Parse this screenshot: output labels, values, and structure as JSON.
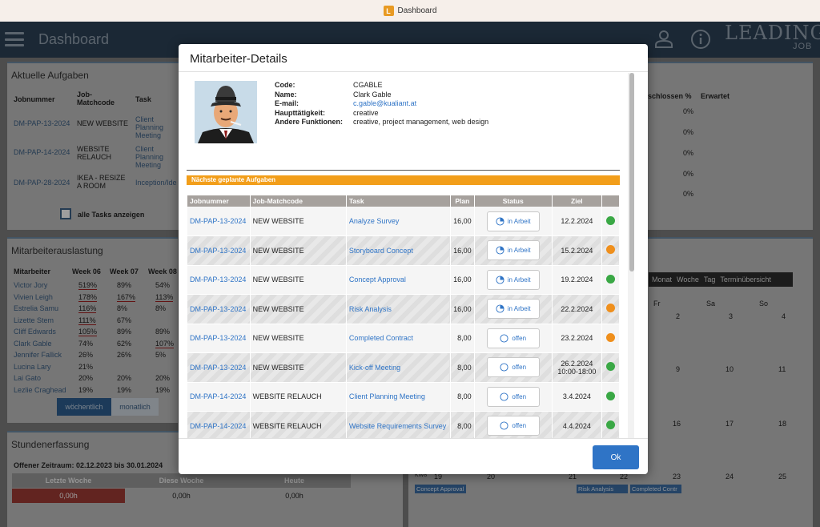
{
  "window": {
    "title": "Dashboard",
    "badge": "L"
  },
  "header": {
    "title": "Dashboard",
    "logo_main": "LEADING",
    "logo_sub": "JOB"
  },
  "background": {
    "tasks_panel": {
      "title": "Aktuelle Aufgaben",
      "columns": [
        "Jobnummer",
        "Job-Matchcode",
        "Task"
      ],
      "rows": [
        {
          "job": "DM-PAP-13-2024",
          "match": "NEW WEBSITE",
          "task": "Client Planning Meeting"
        },
        {
          "job": "DM-PAP-14-2024",
          "match": "WEBSITE RELAUCH",
          "task": "Client Planning Meeting"
        },
        {
          "job": "DM-PAP-28-2024",
          "match": "IKEA - RESIZE A ROOM",
          "task": "Inception/Ide"
        }
      ],
      "checkbox_label": "alle Tasks anzeigen"
    },
    "right_panel": {
      "columns": [
        "schlossen %",
        "Erwartet"
      ],
      "values": [
        "0%",
        "0%",
        "0%",
        "0%",
        "0%"
      ]
    },
    "load_panel": {
      "title": "Mitarbeiterauslastung",
      "columns": [
        "Mitarbeiter",
        "Week 06",
        "Week 07",
        "Week 08"
      ],
      "rows": [
        {
          "name": "Victor Jory",
          "w6": "519%",
          "w7": "89%",
          "w8": "54%"
        },
        {
          "name": "Vivien Leigh",
          "w6": "178%",
          "w7": "167%",
          "w8": "113%"
        },
        {
          "name": "Estrelia Samu",
          "w6": "116%",
          "w7": "8%",
          "w8": "8%"
        },
        {
          "name": "Lizette Stem",
          "w6": "111%",
          "w7": "67%",
          "w8": ""
        },
        {
          "name": "Cliff Edwards",
          "w6": "105%",
          "w7": "89%",
          "w8": "89%"
        },
        {
          "name": "Clark Gable",
          "w6": "74%",
          "w7": "62%",
          "w8": "107%"
        },
        {
          "name": "Jennifer Fallick",
          "w6": "26%",
          "w7": "26%",
          "w8": "5%"
        },
        {
          "name": "Lucina Lary",
          "w6": "21%",
          "w7": "",
          "w8": ""
        },
        {
          "name": "Lai Gato",
          "w6": "20%",
          "w7": "20%",
          "w8": "20%"
        },
        {
          "name": "Lezlie Craghead",
          "w6": "19%",
          "w7": "19%",
          "w8": "19%"
        }
      ],
      "toggle_weekly": "wöchentlich",
      "toggle_monthly": "monatlich"
    },
    "time_panel": {
      "title": "Stundenerfassung",
      "period": "Offener Zeitraum: 02.12.2023 bis 30.01.2024",
      "columns": [
        "Letzte Woche",
        "Diese Woche",
        "Heute"
      ],
      "values": [
        "0,00h",
        "0,00h",
        "0,00h"
      ]
    },
    "calendar": {
      "views": [
        "Monat",
        "Woche",
        "Tag",
        "Terminübersicht"
      ],
      "weekdays": [
        "Fr",
        "Sa",
        "So"
      ],
      "week1": [
        "2",
        "3",
        "4"
      ],
      "week2": [
        "9",
        "10",
        "11"
      ],
      "week3": [
        "16",
        "17",
        "18"
      ],
      "week4_label": "KW8",
      "week4": [
        "19",
        "20",
        "21",
        "22",
        "23",
        "24",
        "25"
      ],
      "events": [
        "Concept Approval",
        "Risk Analysis",
        "Completed Contr"
      ]
    }
  },
  "modal": {
    "title": "Mitarbeiter-Details",
    "info": [
      {
        "label": "Code:",
        "value": "CGABLE"
      },
      {
        "label": "Name:",
        "value": "Clark Gable"
      },
      {
        "label": "E-mail:",
        "value": "c.gable@kualiant.at"
      },
      {
        "label": "Haupttätigkeit:",
        "value": "creative"
      },
      {
        "label": "Andere Funktionen:",
        "value": "creative, project management, web design"
      }
    ],
    "section_title": "Nächste geplante Aufgaben",
    "columns": [
      "Jobnummer",
      "Job-Matchcode",
      "Task",
      "Plan",
      "Status",
      "Ziel",
      ""
    ],
    "rows": [
      {
        "job": "DM-PAP-13-2024",
        "match": "NEW WEBSITE",
        "task": "Analyze Survey",
        "plan": "16,00",
        "status": "in Arbeit",
        "ziel": "12.2.2024",
        "dot": "#3aa845"
      },
      {
        "job": "DM-PAP-13-2024",
        "match": "NEW WEBSITE",
        "task": "Storyboard Concept",
        "plan": "16,00",
        "status": "in Arbeit",
        "ziel": "15.2.2024",
        "dot": "#ef8f1c"
      },
      {
        "job": "DM-PAP-13-2024",
        "match": "NEW WEBSITE",
        "task": "Concept Approval",
        "plan": "16,00",
        "status": "in Arbeit",
        "ziel": "19.2.2024",
        "dot": "#3aa845"
      },
      {
        "job": "DM-PAP-13-2024",
        "match": "NEW WEBSITE",
        "task": "Risk Analysis",
        "plan": "16,00",
        "status": "in Arbeit",
        "ziel": "22.2.2024",
        "dot": "#ef8f1c"
      },
      {
        "job": "DM-PAP-13-2024",
        "match": "NEW WEBSITE",
        "task": "Completed Contract",
        "plan": "8,00",
        "status": "offen",
        "ziel": "23.2.2024",
        "dot": "#ef8f1c"
      },
      {
        "job": "DM-PAP-13-2024",
        "match": "NEW WEBSITE",
        "task": "Kick-off Meeting",
        "plan": "8,00",
        "status": "offen",
        "ziel": "26.2.2024 10:00-18:00",
        "dot": "#3aa845"
      },
      {
        "job": "DM-PAP-14-2024",
        "match": "WEBSITE RELAUCH",
        "task": "Client Planning Meeting",
        "plan": "8,00",
        "status": "offen",
        "ziel": "3.4.2024",
        "dot": "#3aa845"
      },
      {
        "job": "DM-PAP-14-2024",
        "match": "WEBSITE RELAUCH",
        "task": "Website Requirements Survey",
        "plan": "8,00",
        "status": "offen",
        "ziel": "4.4.2024",
        "dot": "#3aa845"
      }
    ],
    "ok_label": "Ok"
  }
}
